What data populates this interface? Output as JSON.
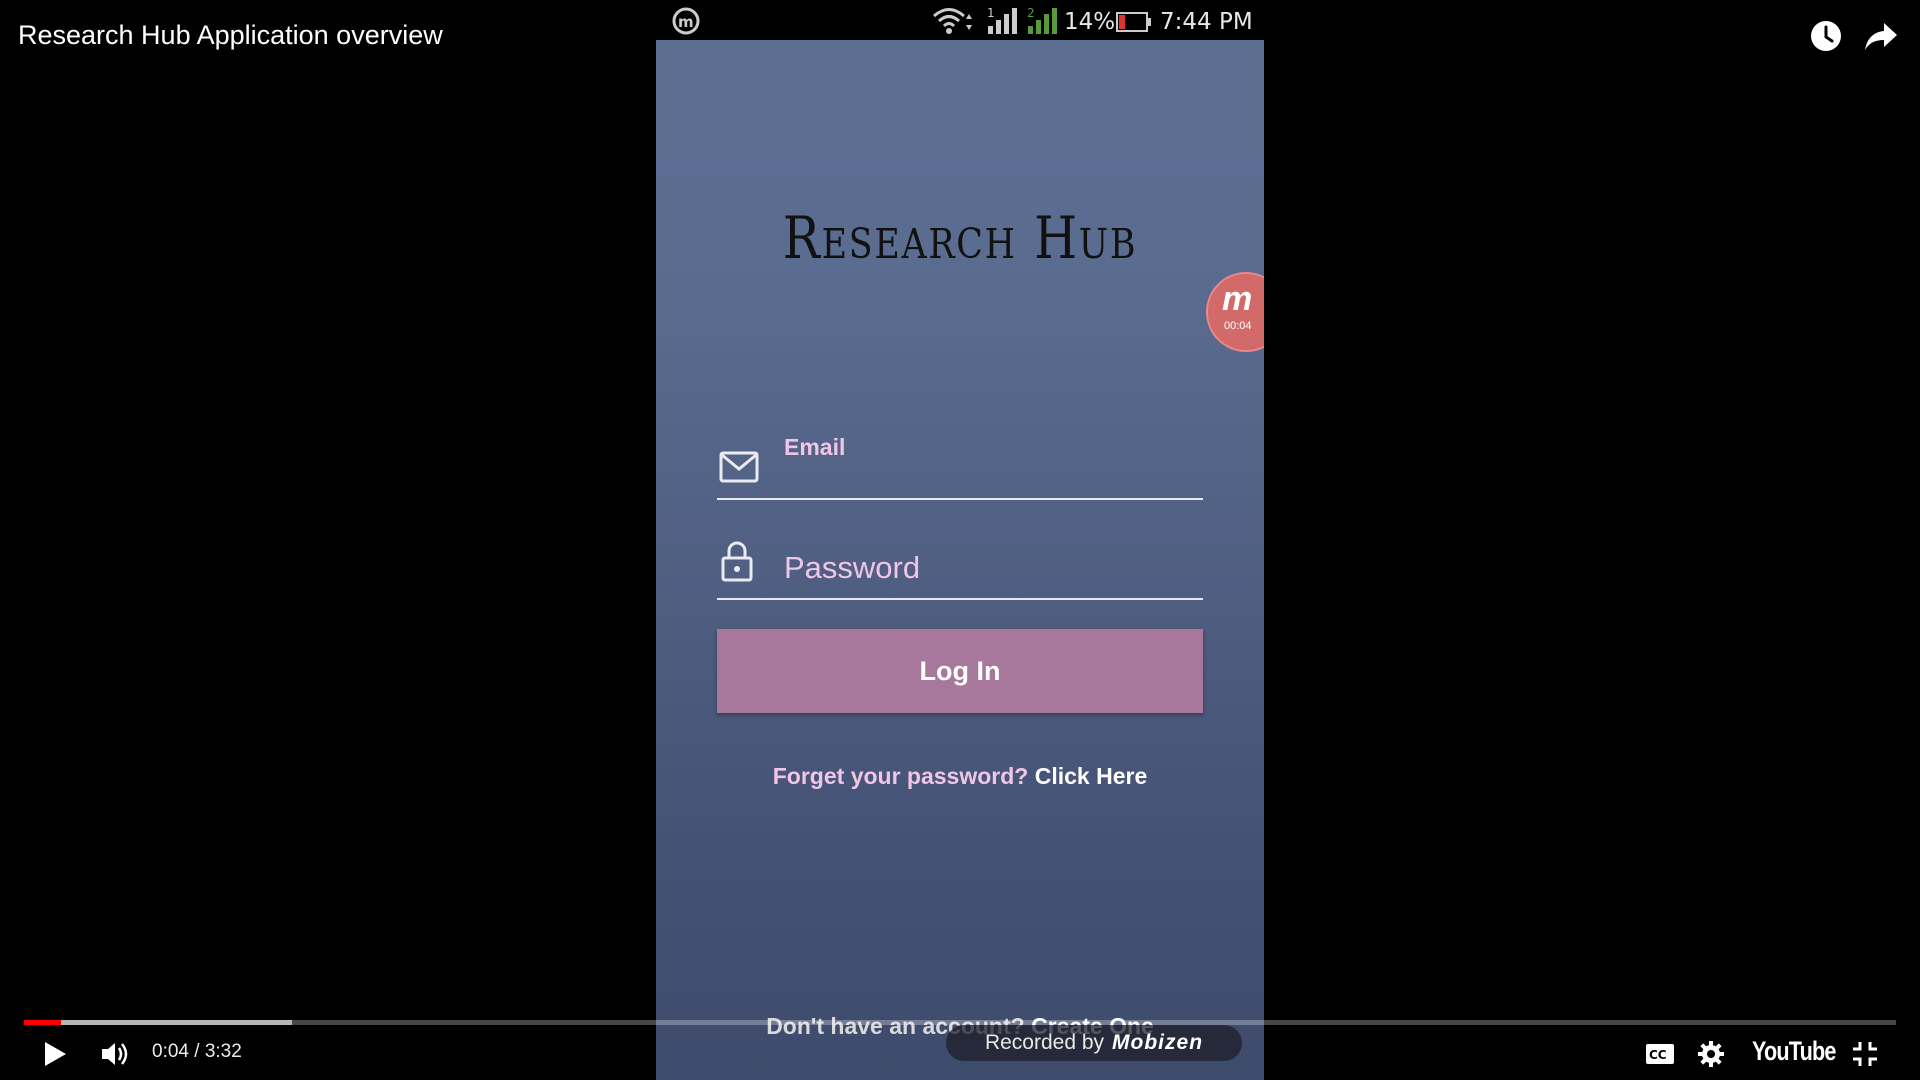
{
  "video": {
    "title": "Research Hub Application overview",
    "time": "0:04 / 3:32",
    "progress_played": 0.02,
    "progress_buffered": 0.143,
    "youtube_logo": "YouTube"
  },
  "phone": {
    "status": {
      "battery_pct": "14%",
      "time": "7:44 PM"
    },
    "app": {
      "logo_text": "Research Hub",
      "email_label": "Email",
      "password_placeholder": "Password",
      "login_label": "Log In",
      "forgot_text": "Forget your password? ",
      "forgot_link": "Click Here",
      "signup_text": "Don't have an account? ",
      "signup_link": "Create One"
    },
    "recorder": {
      "float_letter": "m",
      "float_time": "00:04",
      "watermark_prefix": "Recorded by",
      "watermark_brand": "Mobizen"
    }
  },
  "colors": {
    "accent_button": "#a8779c",
    "accent_text": "#f0c6e6",
    "progress": "#ff0000"
  },
  "icons": [
    "watch-later-icon",
    "share-icon",
    "email-icon",
    "lock-icon",
    "play-icon",
    "volume-icon",
    "cc-icon",
    "settings-icon",
    "fullscreen-exit-icon"
  ]
}
